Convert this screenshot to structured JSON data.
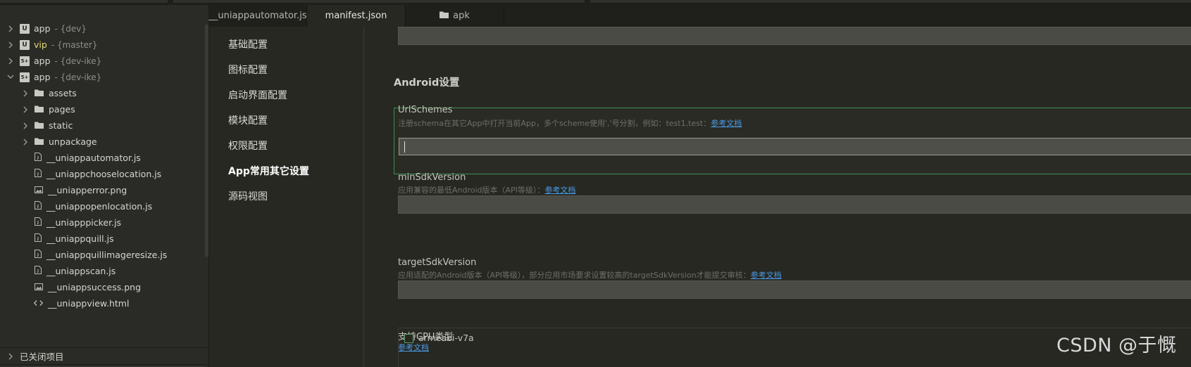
{
  "sidebar": {
    "projects": [
      {
        "name": "app",
        "branch": "- {dev}",
        "icon": "U",
        "expanded": false
      },
      {
        "name": "vip",
        "branch": "- {master}",
        "icon": "U",
        "expanded": false
      },
      {
        "name": "app",
        "branch": "- {dev-ike}",
        "icon": "5+",
        "expanded": false
      },
      {
        "name": "app",
        "branch": "- {dev-ike}",
        "icon": "5+",
        "expanded": true
      }
    ],
    "folders": [
      "assets",
      "pages",
      "static",
      "unpackage"
    ],
    "files": [
      {
        "name": "__uniappautomator.js",
        "type": "file"
      },
      {
        "name": "__uniappchooselocation.js",
        "type": "file"
      },
      {
        "name": "__uniapperror.png",
        "type": "image"
      },
      {
        "name": "__uniappopenlocation.js",
        "type": "file"
      },
      {
        "name": "__uniapppicker.js",
        "type": "file"
      },
      {
        "name": "__uniappquill.js",
        "type": "file"
      },
      {
        "name": "__uniappquillimageresize.js",
        "type": "file"
      },
      {
        "name": "__uniappscan.js",
        "type": "file"
      },
      {
        "name": "__uniappsuccess.png",
        "type": "image"
      },
      {
        "name": "__uniappview.html",
        "type": "code"
      }
    ],
    "closed_projects": "已关闭项目"
  },
  "tabs": [
    {
      "label": "__uniappautomator.js"
    },
    {
      "label": "manifest.json",
      "active": true
    },
    {
      "label": "apk",
      "folder": true
    }
  ],
  "nav": {
    "items": [
      "基础配置",
      "图标配置",
      "启动界面配置",
      "模块配置",
      "权限配置",
      "App常用其它设置",
      "源码视图"
    ],
    "active_index": 5
  },
  "content": {
    "section_title": "Android设置",
    "url_schemes": {
      "label": "UrlSchemes",
      "hint": "注册schema在其它App中打开当前App，多个scheme使用','号分割，例如：test1,test：",
      "link": "参考文档",
      "value": ""
    },
    "min_sdk": {
      "label": "minSdkVersion",
      "hint": "应用兼容的最低Android版本（API等级）：",
      "link": "参考文档",
      "value": ""
    },
    "target_sdk": {
      "label": "targetSdkVersion",
      "hint": "应用适配的Android版本（API等级），部分应用市场要求设置较高的targetSdkVersion才能提交审核：",
      "link": "参考文档",
      "value": ""
    },
    "cpu": {
      "label": "支持CPU类型",
      "link": "参考文档",
      "options": [
        "armeabi-v7a"
      ]
    }
  },
  "watermark": "CSDN @于慨",
  "colors": {
    "background": "#272822",
    "sidebar": "#2a2b26",
    "focus_border": "#3f8f4f",
    "link": "#4a9be8",
    "branch_highlight": "#e6db74"
  }
}
